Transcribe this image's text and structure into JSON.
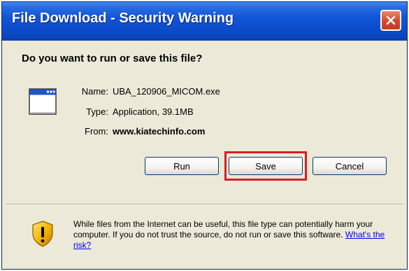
{
  "window": {
    "title": "File Download - Security Warning"
  },
  "dialog": {
    "question": "Do you want to run or save this file?",
    "file": {
      "icon": "application-window-icon",
      "name_label": "Name:",
      "name_value": "UBA_120906_MICOM.exe",
      "type_label": "Type:",
      "type_value": "Application, 39.1MB",
      "from_label": "From:",
      "from_value": "www.kiatechinfo.com"
    },
    "buttons": {
      "run": "Run",
      "save": "Save",
      "cancel": "Cancel"
    }
  },
  "warning": {
    "icon": "security-shield-icon",
    "text": "While files from the Internet can be useful, this file type can potentially harm your computer. If you do not trust the source, do not run or save this software.",
    "link": "What's the risk?"
  },
  "colors": {
    "titlebar": "#0d4ccc",
    "close_button": "#d2472c",
    "highlight": "#d81e28",
    "link": "#0000ee",
    "dialog_bg": "#ece9d8"
  }
}
